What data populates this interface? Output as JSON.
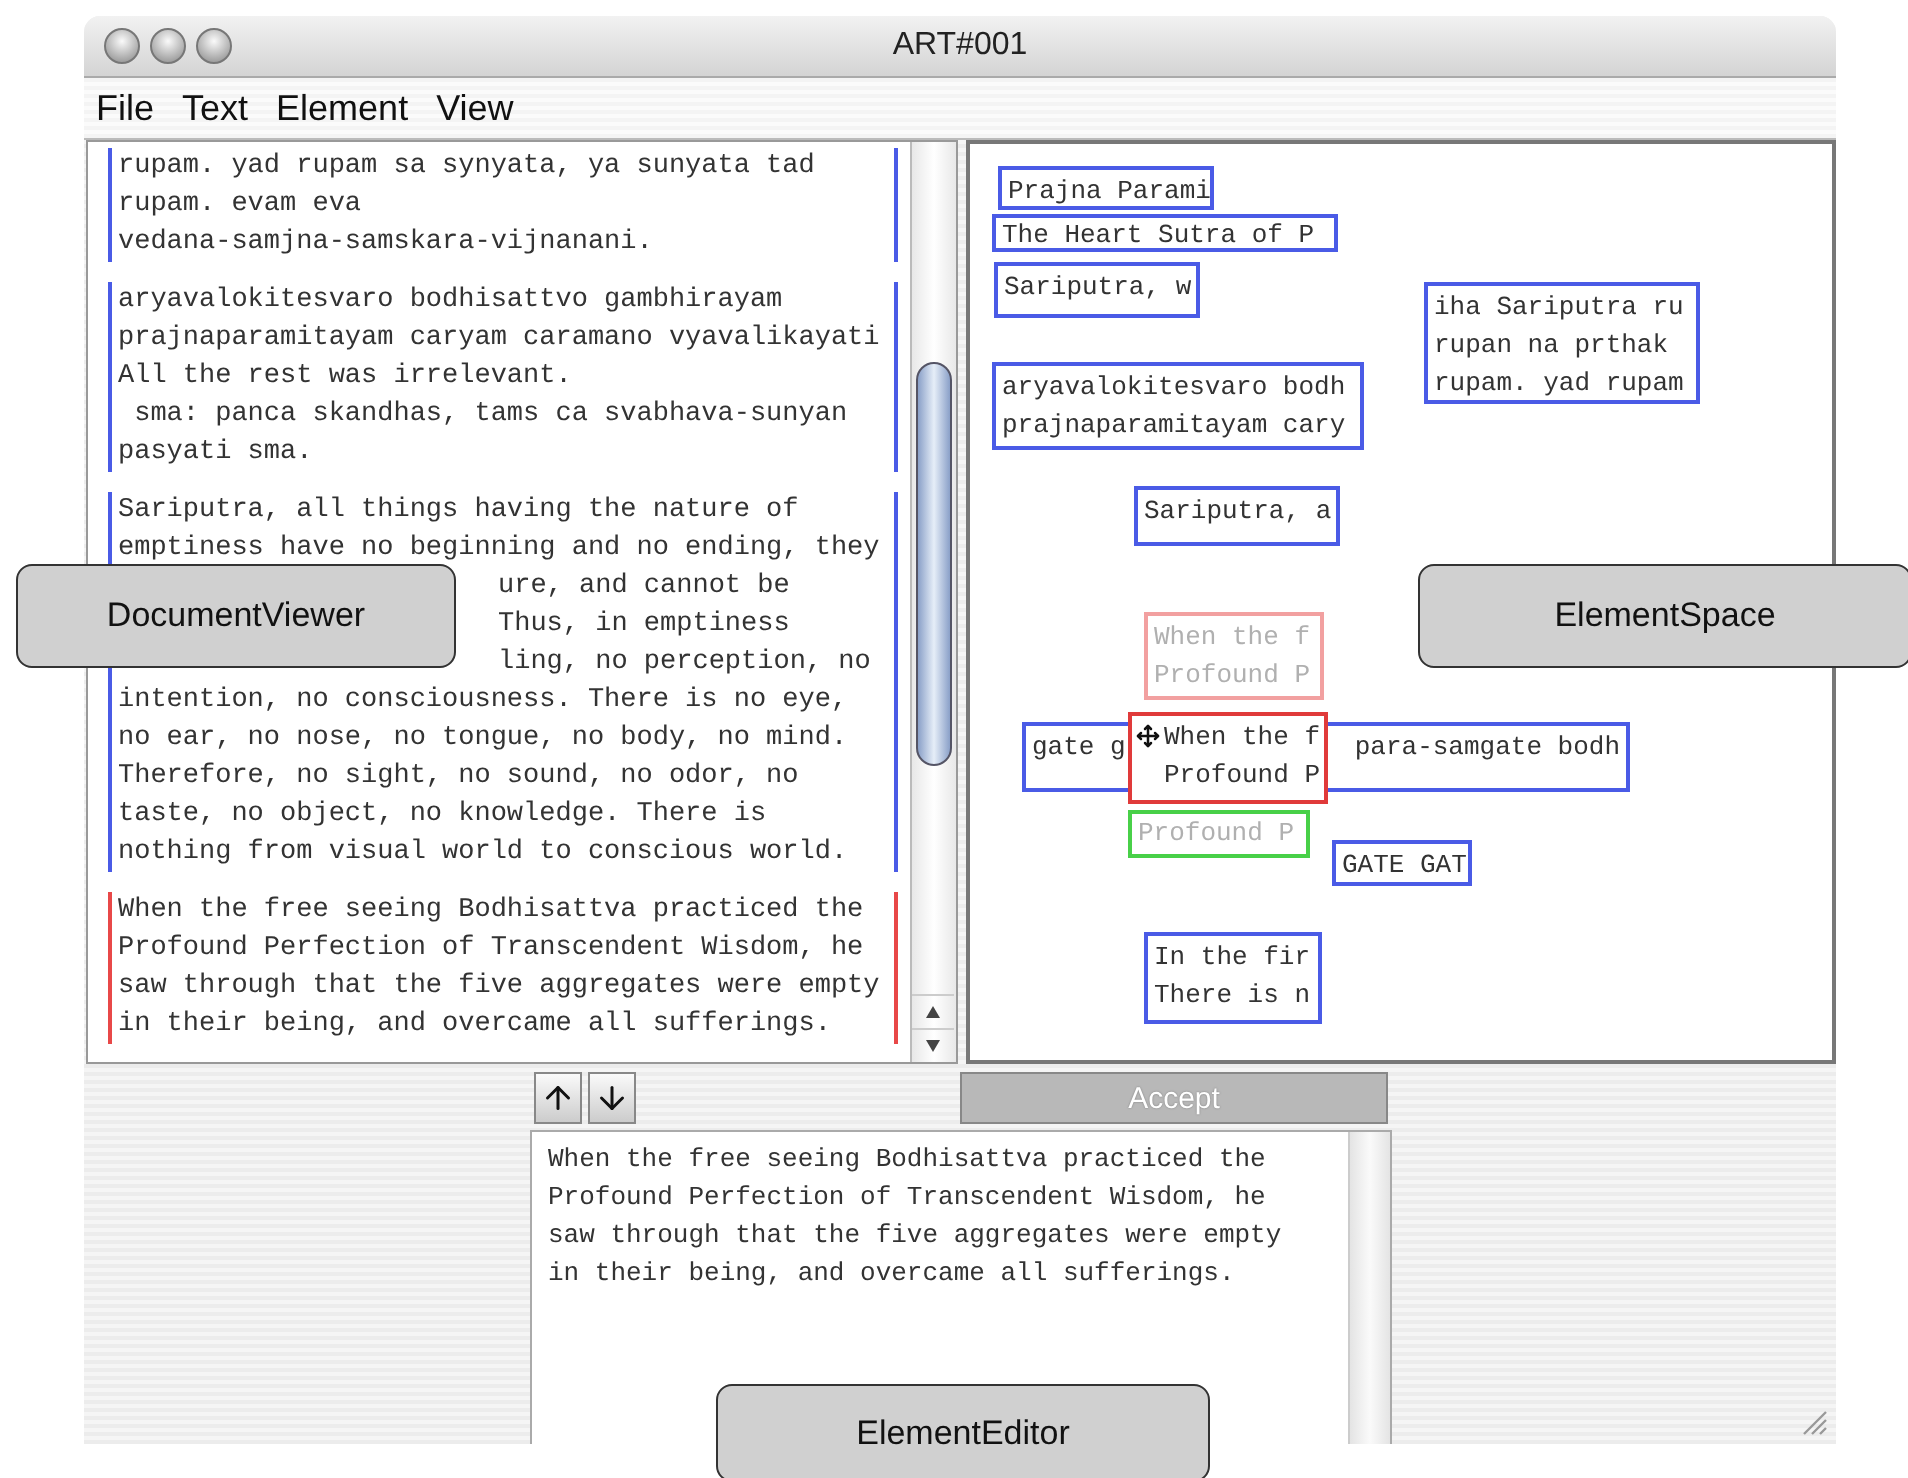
{
  "window": {
    "title": "ART#001"
  },
  "menu": [
    "File",
    "Text",
    "Element",
    "View"
  ],
  "document_viewer": {
    "paragraphs": [
      {
        "color": "#4a5be6",
        "lines": [
          {
            "text": "rupam. yad rupam sa synyata, ya sunyata tad",
            "covered": false
          },
          {
            "text": "rupam. evam eva",
            "covered": false
          },
          {
            "text": "vedana-samjna-samskara-vijnanani.",
            "covered": false
          }
        ]
      },
      {
        "color": "#4a5be6",
        "lines": [
          {
            "text": "aryavalokitesvaro bodhisattvo gambhirayam",
            "covered": false
          },
          {
            "text": "prajnaparamitayam caryam caramano vyavalikayati",
            "covered": false
          },
          {
            "text": "All the rest was irrelevant.",
            "covered": false
          },
          {
            "text": " sma: panca skandhas, tams ca svabhava-sunyan",
            "covered": false
          },
          {
            "text": "pasyati sma.",
            "covered": false
          }
        ]
      },
      {
        "color": "#4a5be6",
        "lines": [
          {
            "text": "Sariputra, all things having the nature of",
            "covered": false
          },
          {
            "text": "emptiness have no beginning and no ending, they",
            "covered": false
          },
          {
            "text": "ure, and cannot be",
            "covered": true
          },
          {
            "text": "Thus, in emptiness",
            "covered": true
          },
          {
            "text": "ling, no perception, no",
            "covered": true
          },
          {
            "text": "intention, no consciousness. There is no eye,",
            "covered": false
          },
          {
            "text": "no ear, no nose, no tongue, no body, no mind.",
            "covered": false
          },
          {
            "text": "Therefore, no sight, no sound, no odor, no",
            "covered": false
          },
          {
            "text": "taste, no object, no knowledge. There is",
            "covered": false
          },
          {
            "text": "nothing from visual world to conscious world.",
            "covered": false
          }
        ]
      },
      {
        "color": "#e84848",
        "lines": [
          {
            "text": "When the free seeing Bodhisattva practiced the",
            "covered": false
          },
          {
            "text": "Profound Perfection of Transcendent Wisdom, he",
            "covered": false
          },
          {
            "text": "saw through that the five aggregates were empty",
            "covered": false
          },
          {
            "text": "in their being, and overcame all sufferings.",
            "covered": false
          }
        ]
      }
    ]
  },
  "element_space": {
    "elements": [
      {
        "kind": "block",
        "color": "#4a5be6",
        "faded": false,
        "lines": [
          "Prajna Parami"
        ]
      },
      {
        "kind": "block",
        "color": "#4a5be6",
        "faded": false,
        "lines": [
          "The Heart Sutra of P"
        ]
      },
      {
        "kind": "block",
        "color": "#4a5be6",
        "faded": false,
        "lines": [
          "Sariputra, w"
        ]
      },
      {
        "kind": "block",
        "color": "#4a5be6",
        "faded": false,
        "lines": [
          "aryavalokitesvaro bodh",
          "prajnaparamitayam cary"
        ]
      },
      {
        "kind": "block",
        "color": "#4a5be6",
        "faded": false,
        "lines": [
          "iha Sariputra ru",
          "rupan na prthak",
          "rupam. yad rupam"
        ]
      },
      {
        "kind": "block",
        "color": "#4a5be6",
        "faded": false,
        "lines": [
          "Sariputra, a"
        ]
      },
      {
        "kind": "block",
        "color": "#f2a0a0",
        "faded": true,
        "lines": [
          "When the f",
          "Profound P"
        ]
      },
      {
        "kind": "split",
        "color": "#4a5be6",
        "faded": false,
        "lines": [
          "gate g",
          "para-samgate bodh"
        ]
      },
      {
        "kind": "block",
        "color": "#e03a3a",
        "faded": false,
        "selected": true,
        "lines": [
          "When the f",
          "Profound P"
        ]
      },
      {
        "kind": "bottom",
        "color": "#48d048",
        "faded": true,
        "lines": [
          "Profound P"
        ]
      },
      {
        "kind": "block",
        "color": "#4a5be6",
        "faded": false,
        "lines": [
          "GATE GAT"
        ]
      },
      {
        "kind": "block",
        "color": "#4a5be6",
        "faded": false,
        "lines": [
          "In the fir",
          "There is n"
        ]
      }
    ]
  },
  "element_editor": {
    "accept": {
      "label": "Accept",
      "disabled": true
    },
    "text": "When the free seeing Bodhisattva practiced the\nProfound Perfection of Transcendent Wisdom, he\nsaw through that the five aggregates were empty\nin their being, and overcame all sufferings."
  },
  "callouts": [
    {
      "label": "DocumentViewer"
    },
    {
      "label": "ElementSpace"
    },
    {
      "label": "ElementEditor"
    }
  ]
}
